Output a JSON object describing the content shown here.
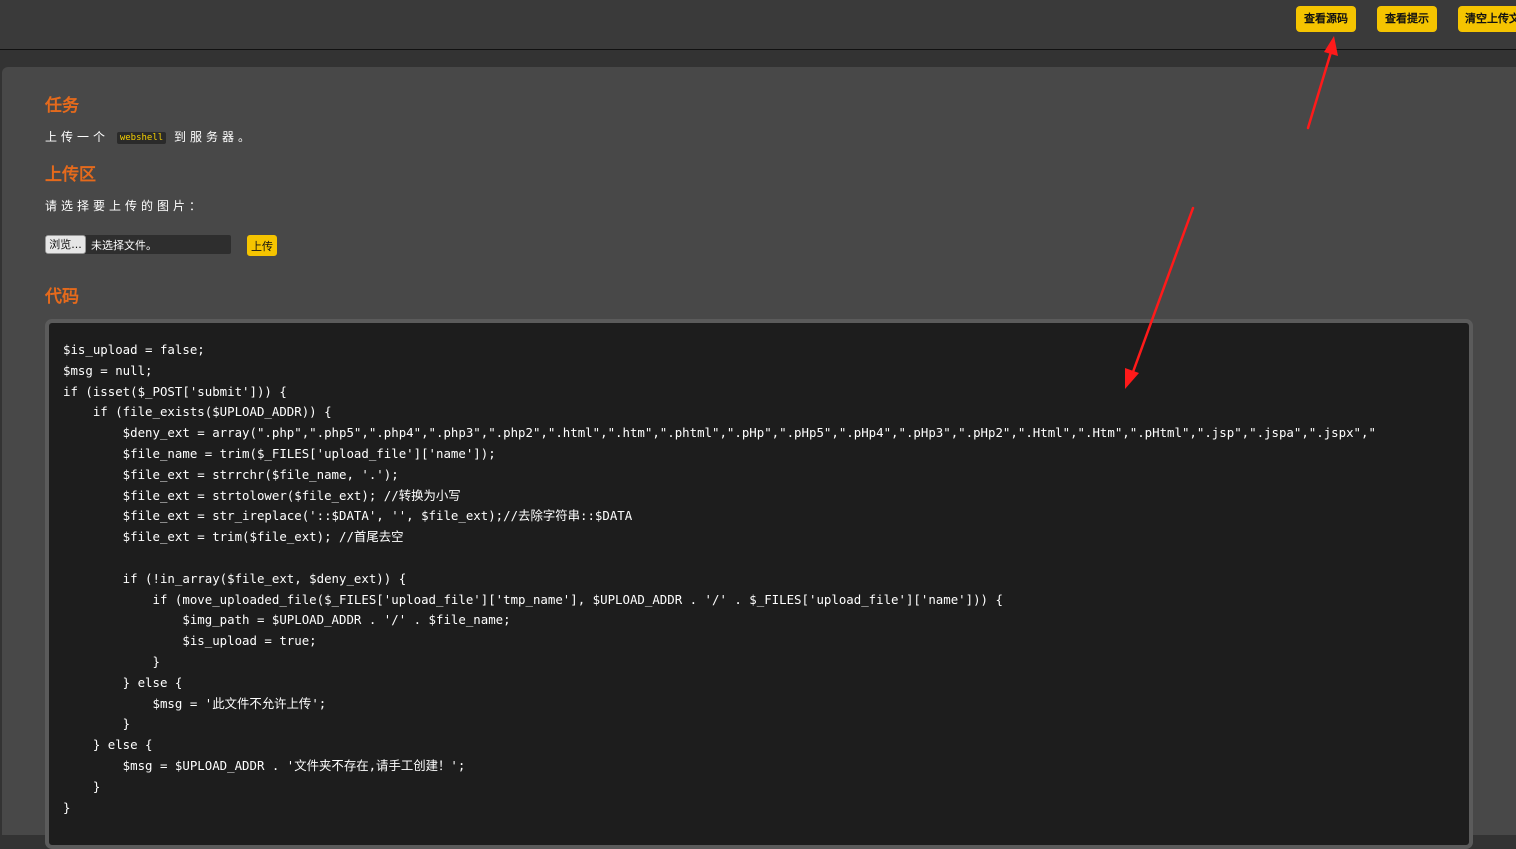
{
  "toolbar": {
    "view_source": "查看源码",
    "view_hint": "查看提示",
    "clear_uploads": "清空上传文"
  },
  "task": {
    "heading": "任务",
    "text_before": "上传一个",
    "code_word": "webshell",
    "text_after": "到服务器。"
  },
  "upload": {
    "heading": "上传区",
    "prompt": "请选择要上传的图片：",
    "browse_label": "浏览...",
    "no_file_text": "未选择文件。",
    "submit_label": "上传"
  },
  "code": {
    "heading": "代码",
    "source": "$is_upload = false;\n$msg = null;\nif (isset($_POST['submit'])) {\n    if (file_exists($UPLOAD_ADDR)) {\n        $deny_ext = array(\".php\",\".php5\",\".php4\",\".php3\",\".php2\",\".html\",\".htm\",\".phtml\",\".pHp\",\".pHp5\",\".pHp4\",\".pHp3\",\".pHp2\",\".Html\",\".Htm\",\".pHtml\",\".jsp\",\".jspa\",\".jspx\",\"\n        $file_name = trim($_FILES['upload_file']['name']);\n        $file_ext = strrchr($file_name, '.');\n        $file_ext = strtolower($file_ext); //转换为小写\n        $file_ext = str_ireplace('::$DATA', '', $file_ext);//去除字符串::$DATA\n        $file_ext = trim($file_ext); //首尾去空\n\n        if (!in_array($file_ext, $deny_ext)) {\n            if (move_uploaded_file($_FILES['upload_file']['tmp_name'], $UPLOAD_ADDR . '/' . $_FILES['upload_file']['name'])) {\n                $img_path = $UPLOAD_ADDR . '/' . $file_name;\n                $is_upload = true;\n            }\n        } else {\n            $msg = '此文件不允许上传';\n        }\n    } else {\n        $msg = $UPLOAD_ADDR . '文件夹不存在,请手工创建！';\n    }\n}"
  },
  "colors": {
    "accent_button": "#f5c400",
    "heading": "#e56a1c",
    "annotation_arrow": "#ff1a1a"
  }
}
